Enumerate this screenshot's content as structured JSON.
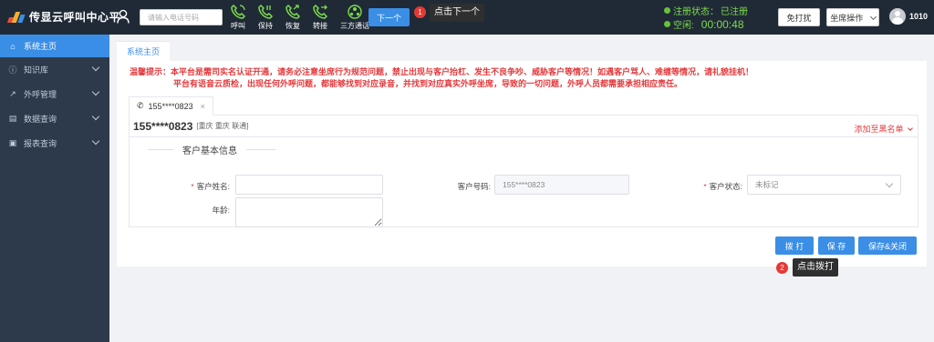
{
  "app": {
    "title": "传显云呼叫中心平"
  },
  "header": {
    "phone_placeholder": "请输入电话号码",
    "tools": [
      {
        "label": "呼叫",
        "icon": "phone-call-icon"
      },
      {
        "label": "保持",
        "icon": "phone-hold-icon"
      },
      {
        "label": "恢复",
        "icon": "phone-resume-icon"
      },
      {
        "label": "转接",
        "icon": "phone-transfer-icon"
      },
      {
        "label": "三方通话",
        "icon": "three-way-call-icon"
      }
    ],
    "next_label": "下一个",
    "step1_badge": "1",
    "step1_tip": "点击下一个",
    "reg_label": "注册状态：",
    "reg_value": "已注册",
    "idle_label": "空闲:",
    "timer": "00:00:48",
    "dnd_label": "免打扰",
    "seat_label": "坐席操作",
    "user_id": "1010"
  },
  "sidebar": {
    "items": [
      {
        "label": "系统主页",
        "icon": "home-icon",
        "active": true
      },
      {
        "label": "知识库",
        "icon": "help-circle-icon",
        "active": false
      },
      {
        "label": "外呼管理",
        "icon": "outbound-call-icon",
        "active": false
      },
      {
        "label": "数据查询",
        "icon": "document-icon",
        "active": false
      },
      {
        "label": "报表查询",
        "icon": "report-icon",
        "active": false
      }
    ]
  },
  "main": {
    "page_tab": "系统主页",
    "notice_line1": "温馨提示：本平台是需司实名认证开通，请务必注意坐席行为规范问题，禁止出现与客户抬杠、发生不良争吵、威胁客户等情况！如遇客户骂人、难缠等情况，请礼貌挂机！",
    "notice_line2": "平台有语音云质检，出现任何外呼问题，都能够找到对应录音，并找到对应真实外呼坐席，导致的一切问题，外呼人员都需要承担相应责任。",
    "call_tab": "155****0823",
    "call_tab_close": "×",
    "customer_phone": "155****0823",
    "customer_location": "[重庆 重庆 联通]",
    "blacklist_label": "添加至黑名单",
    "section_title": "客户基本信息",
    "form": {
      "name_label": "客户姓名:",
      "name_value": "",
      "number_label": "客户号码:",
      "number_value": "155****0823",
      "status_label": "客户状态:",
      "status_value": "未标记",
      "age_label": "年龄:",
      "age_value": ""
    },
    "buttons": {
      "dial": "拨 打",
      "save": "保 存",
      "save_close": "保存&关闭"
    },
    "step2_badge": "2",
    "step2_tip": "点击拨打"
  },
  "colors": {
    "accent": "#3a8ee6",
    "danger": "#e4393c",
    "topbar": "#1f2a36",
    "sidebar": "#2d3a4b",
    "online": "#67c23a"
  }
}
